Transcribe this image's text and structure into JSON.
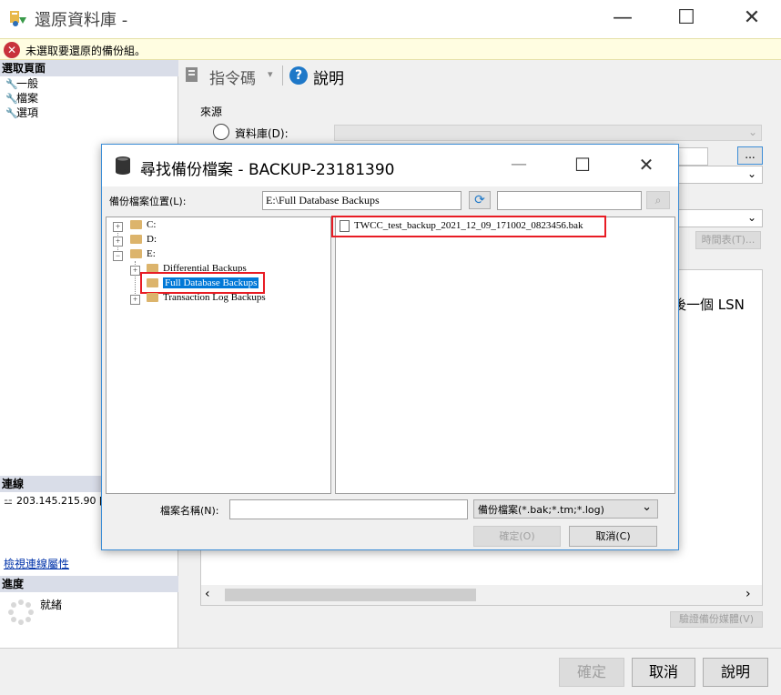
{
  "window": {
    "title": "還原資料庫 -",
    "minimize": "—",
    "maximize": "☐",
    "close": "✕"
  },
  "error": {
    "message": "未選取要還原的備份組。"
  },
  "sidebar": {
    "select_page_header": "選取頁面",
    "pages": [
      {
        "label": "一般"
      },
      {
        "label": "檔案"
      },
      {
        "label": "選項"
      }
    ],
    "connection_header": "連線",
    "server": "203.145.215.90 [s",
    "view_connection_link": "檢視連線屬性",
    "progress_header": "進度",
    "status": "就緒"
  },
  "toolbar": {
    "script_label": "指令碼",
    "help_label": "說明"
  },
  "main": {
    "source_label": "來源",
    "database_radio_label": "資料庫(D):",
    "browse_button": "...",
    "timeline_button": "時間表(T)...",
    "lsn_text": "後一個 LSN",
    "verify_button": "驗證備份媒體(V)"
  },
  "footer": {
    "ok": "確定",
    "cancel": "取消",
    "help": "說明"
  },
  "dialog": {
    "title": "尋找備份檔案 - BACKUP-23181390",
    "location_label": "備份檔案位置(L):",
    "location_value": "E:\\Full Database Backups",
    "search_value": "",
    "tree": {
      "drives": [
        {
          "label": "C:"
        },
        {
          "label": "D:"
        },
        {
          "label": "E:"
        }
      ],
      "e_children": [
        {
          "label": "Differential Backups"
        },
        {
          "label": "Full Database Backups"
        },
        {
          "label": "Transaction Log Backups"
        }
      ]
    },
    "files": [
      {
        "name": "TWCC_test_backup_2021_12_09_171002_0823456.bak"
      }
    ],
    "file_name_label": "檔案名稱(N):",
    "file_name_value": "",
    "file_type": "備份檔案(*.bak;*.tm;*.log)",
    "ok": "確定(O)",
    "cancel": "取消(C)"
  }
}
